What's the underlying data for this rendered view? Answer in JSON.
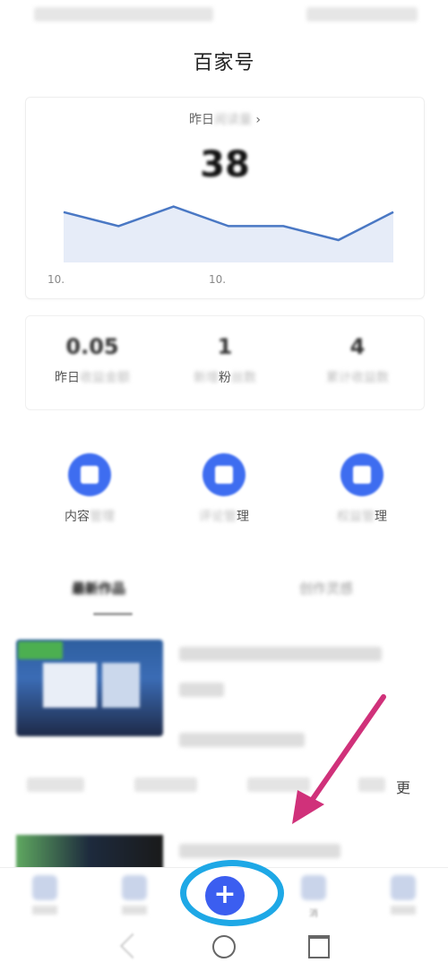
{
  "app_title": "百家号",
  "traffic_card": {
    "label_prefix": "昨日",
    "label_chevron": "›",
    "value": "38",
    "x_ticks": [
      "10.",
      "10.",
      ""
    ]
  },
  "chart_data": {
    "type": "line",
    "x": [
      1,
      2,
      3,
      4,
      5,
      6,
      7
    ],
    "values": [
      38,
      33,
      40,
      33,
      33,
      28,
      38
    ],
    "ylim": [
      20,
      45
    ],
    "color": "#4a78c4",
    "fill": "#e6ecf8"
  },
  "stats": [
    {
      "value": "0.05",
      "label_visible": "昨日"
    },
    {
      "value": "1",
      "label_visible": "粉"
    },
    {
      "value": "4"
    }
  ],
  "tools": [
    {
      "label_visible": "内容"
    },
    {
      "label_visible": "理"
    },
    {
      "label_visible": "理"
    }
  ],
  "tabs": [
    {
      "label": ""
    },
    {
      "label": ""
    }
  ],
  "meta_row": {
    "more_label": "更"
  },
  "bottom_nav": {
    "publish_label": "+",
    "item4_label": "消"
  },
  "colors": {
    "accent": "#3b5ef0",
    "annotation_circle": "#1ea8e6",
    "annotation_arrow": "#d0317a"
  }
}
